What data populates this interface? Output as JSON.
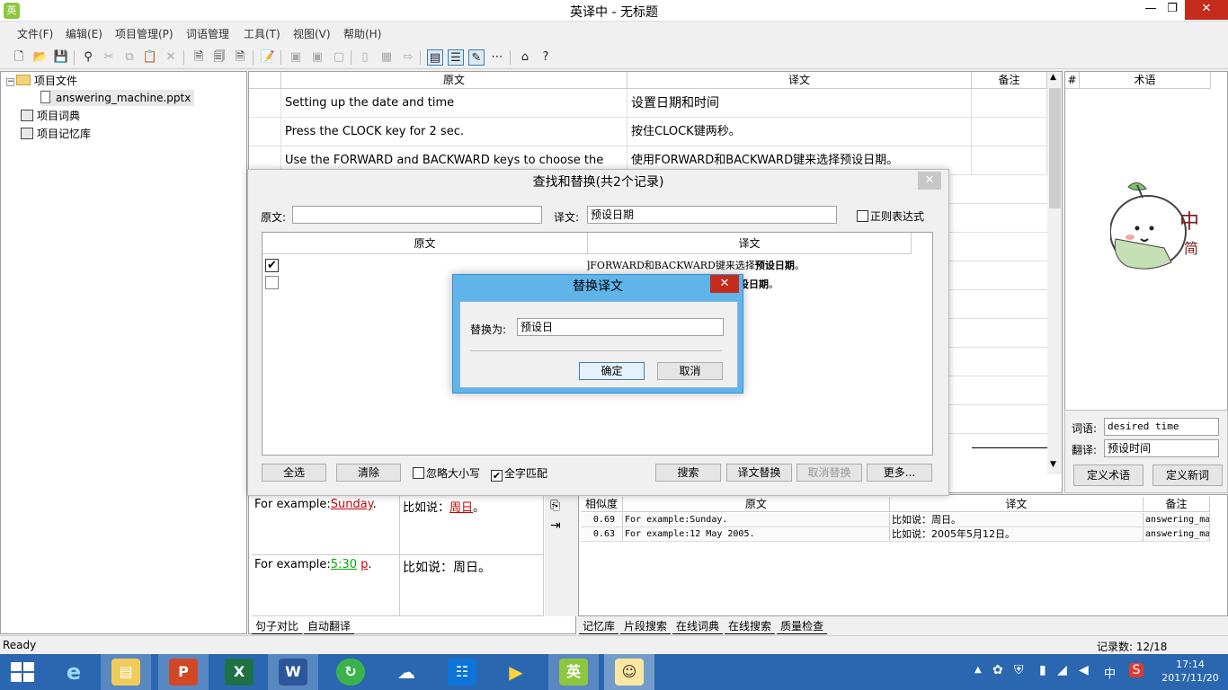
{
  "window": {
    "title": "英译中 - 无标题",
    "app_icon": "英",
    "min": "—",
    "max": "❐",
    "close": "✕"
  },
  "menu": [
    "文件(F)",
    "编辑(E)",
    "项目管理(P)",
    "词语管理",
    "工具(T)",
    "视图(V)",
    "帮助(H)"
  ],
  "tree": {
    "root": "项目文件",
    "file": "answering_machine.pptx",
    "dict": "项目词典",
    "memory": "项目记忆库"
  },
  "grid": {
    "headers": {
      "source": "原文",
      "target": "译文",
      "note": "备注"
    },
    "rows": [
      {
        "source": "Setting up the date and time",
        "target": "设置日期和时间"
      },
      {
        "source": "Press the CLOCK key for 2 sec.",
        "target": "按住CLOCK键两秒。"
      },
      {
        "source": "Use the FORWARD and BACKWARD keys to choose the",
        "target": "使用FORWARD和BACKWARD键来选择预设日期。"
      }
    ]
  },
  "terms": {
    "col_hash": "#",
    "col_term": "术语",
    "mascot_text_1": "中",
    "mascot_text_2": "简",
    "word_label": "词语:",
    "word_value": "desired time",
    "trans_label": "翻译:",
    "trans_value": "预设时间",
    "define_term": "定义术语",
    "define_new": "定义新词"
  },
  "compare": {
    "r1_src_prefix": "For example:",
    "r1_src_hl": "Sunday",
    "r1_src_suffix": ".",
    "r1_tgt_prefix": "比如说：",
    "r1_tgt_hl": "周日",
    "r1_tgt_suffix": "。",
    "r2_src_prefix": "For example:",
    "r2_src_hl1": "5:30",
    "r2_src_hl2": "p",
    "r2_src_suffix": ".",
    "r2_tgt": "比如说：周日。",
    "tabs": [
      "句子对比",
      "自动翻译"
    ]
  },
  "memory": {
    "headers": {
      "score": "相似度",
      "source": "原文",
      "target": "译文",
      "note": "备注"
    },
    "rows": [
      {
        "score": "0.69",
        "source": "For example:Sunday.",
        "target": "比如说：周日。",
        "note": "answering_ma"
      },
      {
        "score": "0.63",
        "source": "For example:12 May 2005.",
        "target": "比如说：2005年5月12日。",
        "note": "answering_ma"
      }
    ],
    "tabs": [
      "记忆库",
      "片段搜索",
      "在线词典",
      "在线搜索",
      "质量检查"
    ]
  },
  "status": {
    "left": "Ready",
    "right": "记录数: 12/18"
  },
  "find_dialog": {
    "title": "查找和替换(共2个记录)",
    "source_label": "原文:",
    "source_value": "",
    "target_label": "译文:",
    "target_value": "预设日期",
    "regex_label": "正则表达式",
    "list_header_source": "原文",
    "list_header_target": "译文",
    "result1_prefix": "]FORWARD和BACKWARD键来选择",
    "result1_hl": "预设日期",
    "result1_suffix": "。",
    "result2_hl": "设日期",
    "result2_suffix": "。",
    "btn_select_all": "全选",
    "btn_clear": "清除",
    "ignore_case": "忽略大小写",
    "whole_word": "全字匹配",
    "btn_search": "搜索",
    "btn_replace": "译文替换",
    "btn_undo": "取消替换",
    "btn_more": "更多..."
  },
  "replace_dialog": {
    "title": "替换译文",
    "label": "替换为:",
    "value": "预设日",
    "ok": "确定",
    "cancel": "取消"
  },
  "taskbar": {
    "time": "17:14",
    "date": "2017/11/20",
    "ime": "中"
  }
}
